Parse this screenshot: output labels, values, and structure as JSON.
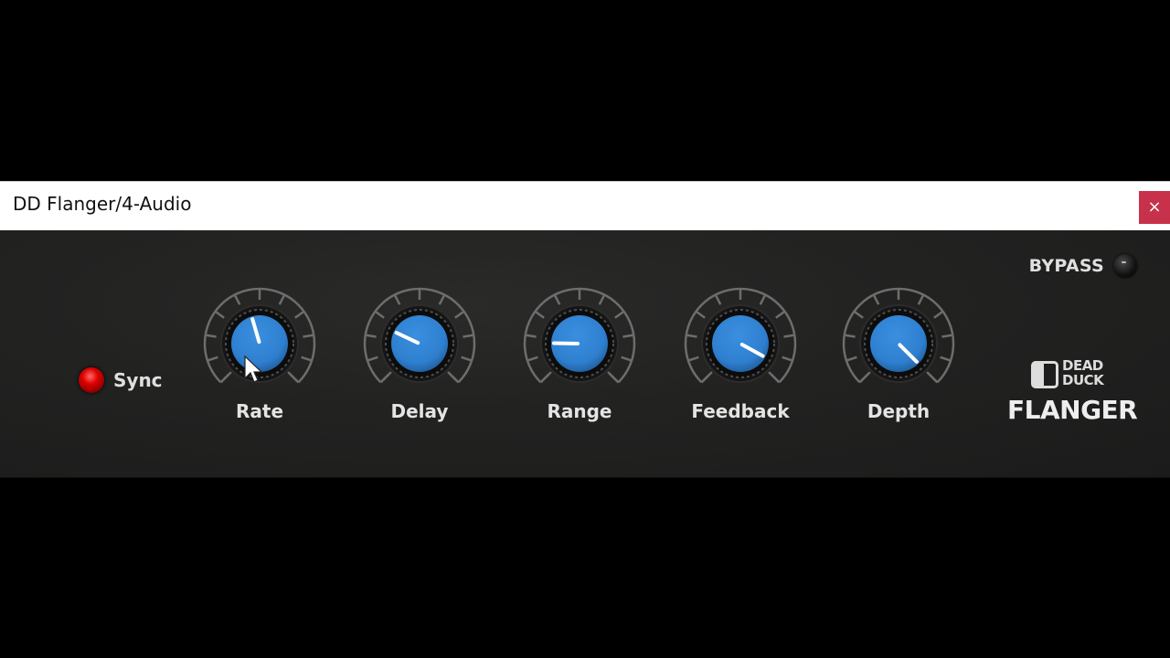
{
  "window": {
    "title": "DD Flanger/4-Audio",
    "close_label": "×"
  },
  "plugin": {
    "bypass_label": "BYPASS",
    "sync_label": "Sync",
    "sync_on": true,
    "brand_line1": "DEAD",
    "brand_line2": "DUCK",
    "product_name": "FLANGER",
    "accent_color": "#2f7fcf",
    "led_color": "#e00000"
  },
  "knobs": [
    {
      "id": "rate",
      "label": "Rate",
      "value": 0.44
    },
    {
      "id": "delay",
      "label": "Delay",
      "value": 0.26
    },
    {
      "id": "range",
      "label": "Range",
      "value": 0.17
    },
    {
      "id": "feedback",
      "label": "Feedback",
      "value": 0.94
    },
    {
      "id": "depth",
      "label": "Depth",
      "value": 1.0
    }
  ]
}
